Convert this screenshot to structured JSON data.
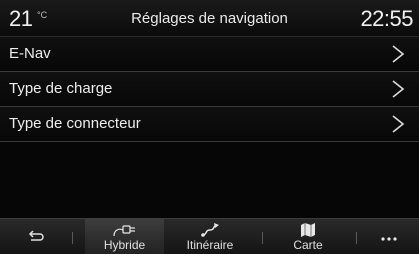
{
  "header": {
    "temperature": "21",
    "temperature_unit": "°C",
    "title": "Réglages de navigation",
    "time": "22:55"
  },
  "menu": {
    "items": [
      {
        "label": "E-Nav"
      },
      {
        "label": "Type de charge"
      },
      {
        "label": "Type de connecteur"
      }
    ]
  },
  "bottombar": {
    "back_icon": "back-arrow-icon",
    "tabs": [
      {
        "label": "Hybride",
        "icon": "charging-plug-icon",
        "active": true
      },
      {
        "label": "Itinéraire",
        "icon": "route-icon",
        "active": false
      },
      {
        "label": "Carte",
        "icon": "map-icon",
        "active": false
      }
    ],
    "more_icon": "more-dots-icon"
  }
}
